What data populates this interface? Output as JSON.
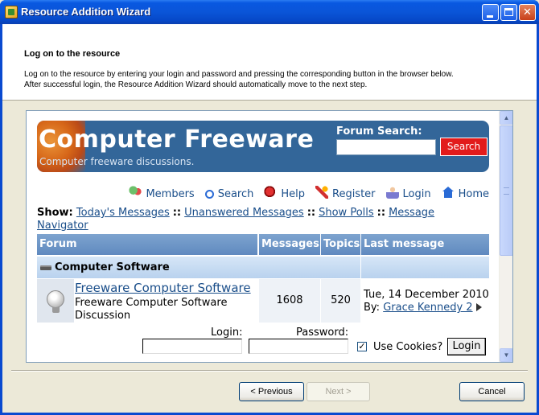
{
  "window": {
    "title": "Resource Addition Wizard"
  },
  "header": {
    "title": "Log on to the resource",
    "desc_line1": "Log on to the resource by entering your login and password and pressing the corresponding button in the browser below.",
    "desc_line2": "After successful login, the Resource Addition Wizard should automatically move to the next step."
  },
  "site": {
    "banner_title": "Computer Freeware",
    "banner_subtitle": "Computer freeware discussions.",
    "search_label": "Forum Search:",
    "search_button": "Search",
    "nav": [
      {
        "label": "Members",
        "icon": "members-icon"
      },
      {
        "label": "Search",
        "icon": "search-icon"
      },
      {
        "label": "Help",
        "icon": "help-icon"
      },
      {
        "label": "Register",
        "icon": "register-icon"
      },
      {
        "label": "Login",
        "icon": "login-icon"
      },
      {
        "label": "Home",
        "icon": "home-icon"
      }
    ],
    "show_label": "Show:",
    "show_links": [
      "Today's Messages",
      "Unanswered Messages",
      "Show Polls",
      "Message",
      "Navigator"
    ],
    "separator": "::",
    "table": {
      "headers": [
        "Forum",
        "Messages",
        "Topics",
        "Last message"
      ],
      "category": "Computer Software",
      "rows": [
        {
          "forum": "Freeware Computer Software",
          "description_line1": "Freeware Computer Software",
          "description_line2": "Discussion",
          "messages": "1608",
          "topics": "520",
          "last_date": "Tue, 14 December 2010",
          "last_by_label": "By:",
          "last_by_user": "Grace Kennedy 2"
        }
      ]
    },
    "login_label": "Login:",
    "password_label": "Password:",
    "cookie_label": "Use Cookies?",
    "cookie_checked": "✓",
    "login_button": "Login"
  },
  "footer": {
    "prev": "< Previous",
    "next": "Next >",
    "cancel": "Cancel"
  }
}
